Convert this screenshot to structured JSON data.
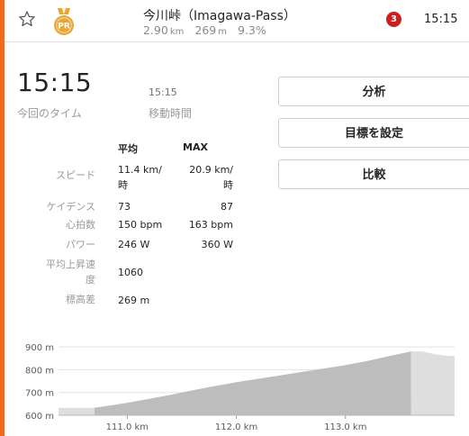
{
  "header": {
    "segment_name": "今川峠（Imagawa-Pass）",
    "distance": "2.90",
    "distance_unit": "km",
    "elevation": "269",
    "elevation_unit": "m",
    "grade": "9.3%",
    "rank": "3",
    "time": "15:15",
    "medal_text": "PR",
    "medal_color": "#e8a735"
  },
  "summary": {
    "elapsed_time": "15:15",
    "elapsed_label": "今回のタイム",
    "moving_time": "15:15",
    "moving_label": "移動時間"
  },
  "buttons": {
    "analyze": "分析",
    "set_goal": "目標を設定",
    "compare": "比較"
  },
  "stats": {
    "headers": [
      "平均",
      "MAX"
    ],
    "rows": [
      {
        "label": "スピード",
        "avg_1": "11.4 km/",
        "avg_2": "時",
        "max_1": "20.9 km/",
        "max_2": "時"
      },
      {
        "label": "ケイデンス",
        "avg": "73",
        "max": "87"
      },
      {
        "label": "心拍数",
        "avg": "150 bpm",
        "max": "163 bpm"
      },
      {
        "label": "パワー",
        "avg": "246 W",
        "max": "360 W"
      },
      {
        "label_1": "平均上昇速",
        "label_2": "度",
        "avg": "1060"
      },
      {
        "label": "標高差",
        "avg": "269 m"
      }
    ]
  },
  "chart_data": {
    "type": "area",
    "y_ticks": [
      "900 m",
      "800 m",
      "700 m",
      "600 m"
    ],
    "x_ticks": [
      "111.0 km",
      "112.0 km",
      "113.0 km"
    ],
    "ylim": [
      600,
      920
    ],
    "xlim": [
      110.37,
      114.0
    ],
    "segment_range": [
      110.7,
      113.6
    ],
    "colors": {
      "segment": "#bdbdbd",
      "outside": "#dedede",
      "grid": "#e3e3e3"
    },
    "x": [
      110.37,
      110.45,
      110.55,
      110.65,
      110.7,
      110.8,
      111.0,
      111.2,
      111.4,
      111.6,
      111.8,
      112.0,
      112.2,
      112.4,
      112.6,
      112.8,
      113.0,
      113.2,
      113.4,
      113.5,
      113.6,
      113.7,
      113.8,
      113.9,
      114.0
    ],
    "y": [
      632,
      632,
      632,
      632,
      633,
      640,
      655,
      672,
      690,
      710,
      728,
      745,
      760,
      775,
      790,
      805,
      820,
      838,
      860,
      870,
      880,
      880,
      870,
      862,
      860
    ]
  }
}
